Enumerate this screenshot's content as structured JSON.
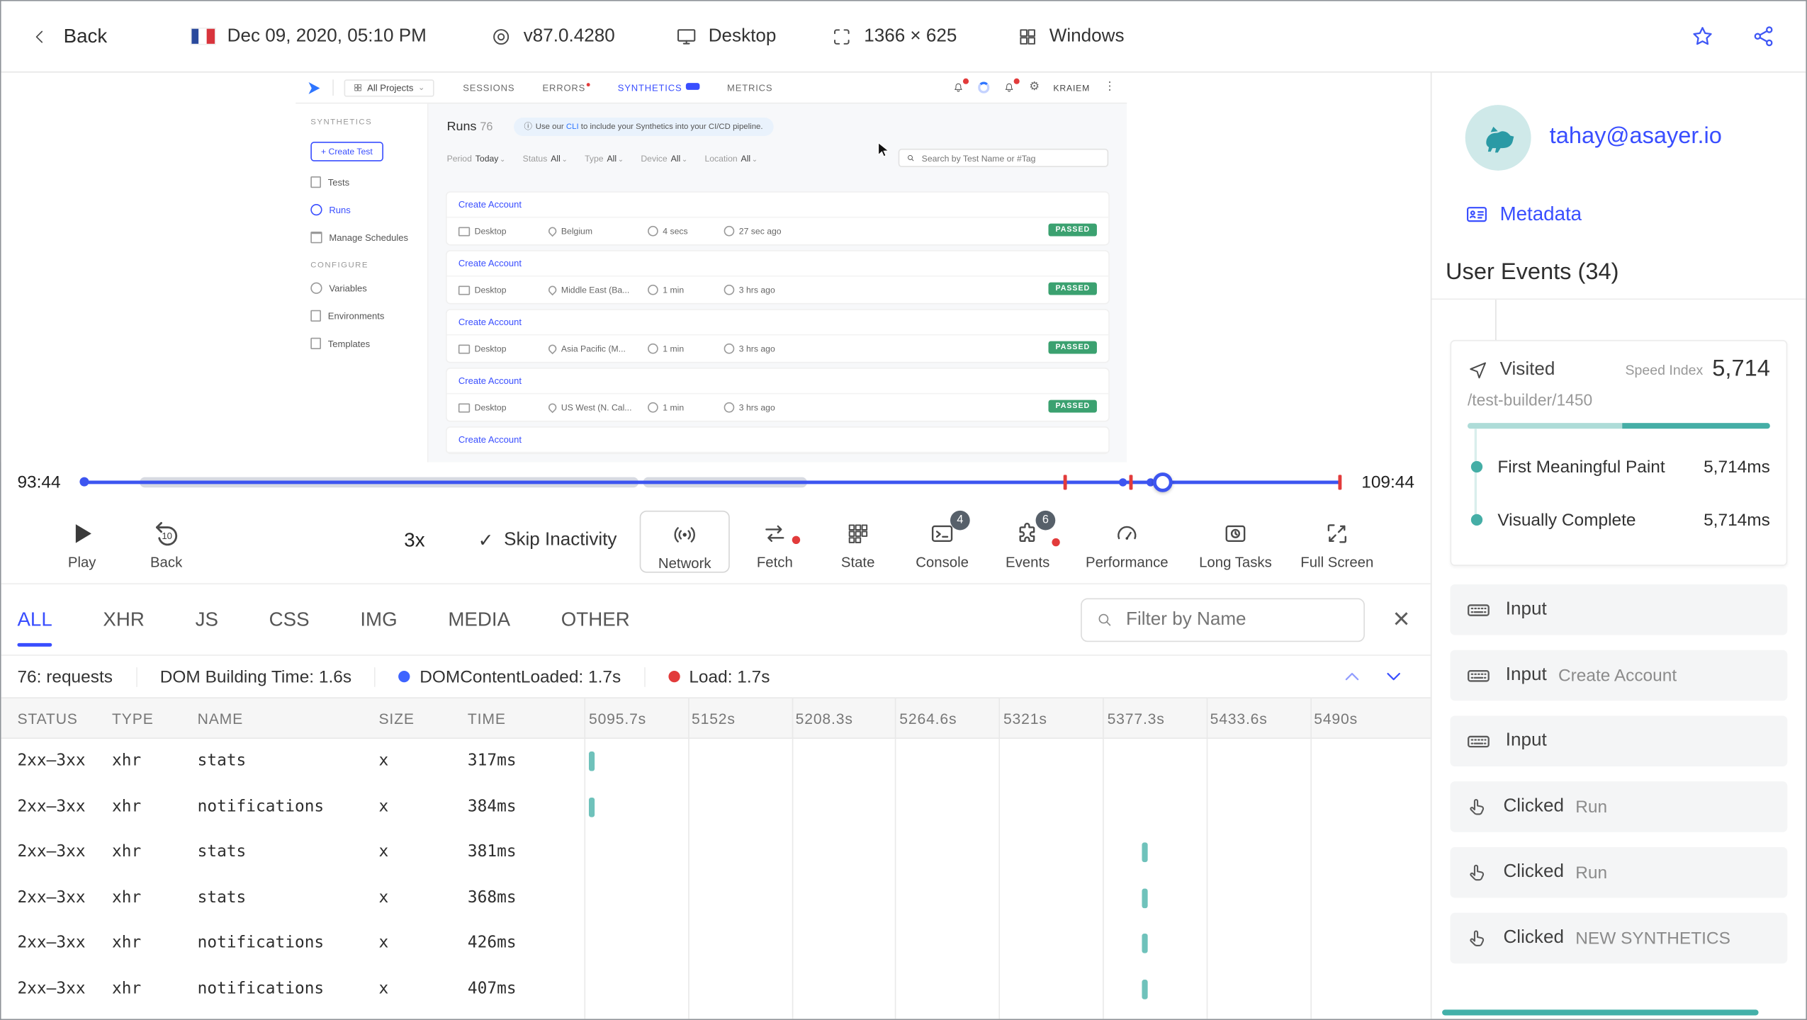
{
  "icons": {
    "caret": "⌄",
    "close": "×",
    "check": "✓",
    "kebab": "⋮",
    "info": "ⓘ",
    "gear": "⚙"
  },
  "topbar": {
    "back_label": "Back",
    "date": "Dec 09, 2020, 05:10 PM",
    "browser_version": "v87.0.4280",
    "device": "Desktop",
    "resolution": "1366 × 625",
    "os": "Windows"
  },
  "app": {
    "project": "All Projects",
    "nav": [
      {
        "label": "SESSIONS"
      },
      {
        "label": "ERRORS"
      },
      {
        "label": "SYNTHETICS"
      },
      {
        "label": "METRICS"
      }
    ],
    "user": "KRAIEM",
    "sidebar": {
      "section_synthetics": "SYNTHETICS",
      "create_test": "+ Create Test",
      "tests": "Tests",
      "runs": "Runs",
      "manage_schedules": "Manage Schedules",
      "section_configure": "CONFIGURE",
      "variables": "Variables",
      "environments": "Environments",
      "templates": "Templates"
    },
    "runs_title": "Runs",
    "runs_count": "76",
    "banner": {
      "pre": "Use our ",
      "link": "CLI",
      "post": " to include your Synthetics into your CI/CD pipeline."
    },
    "filters": [
      {
        "label": "Period",
        "value": "Today"
      },
      {
        "label": "Status",
        "value": "All"
      },
      {
        "label": "Type",
        "value": "All"
      },
      {
        "label": "Device",
        "value": "All"
      },
      {
        "label": "Location",
        "value": "All"
      }
    ],
    "search_placeholder": "Search by Test Name or #Tag",
    "runs": [
      {
        "name": "Create Account",
        "device": "Desktop",
        "location": "Belgium",
        "duration": "4 secs",
        "ago": "27 sec ago",
        "status": "PASSED"
      },
      {
        "name": "Create Account",
        "device": "Desktop",
        "location": "Middle East (Ba...",
        "duration": "1 min",
        "ago": "3 hrs ago",
        "status": "PASSED"
      },
      {
        "name": "Create Account",
        "device": "Desktop",
        "location": "Asia Pacific (M...",
        "duration": "1 min",
        "ago": "3 hrs ago",
        "status": "PASSED"
      },
      {
        "name": "Create Account",
        "device": "Desktop",
        "location": "US West (N. Cal...",
        "duration": "1 min",
        "ago": "3 hrs ago",
        "status": "PASSED"
      },
      {
        "name": "Create Account"
      }
    ]
  },
  "timeline": {
    "current": "93:44",
    "total": "109:44"
  },
  "controls": {
    "play": "Play",
    "back": "Back",
    "back_amount": "10",
    "speed": "3x",
    "skip": "Skip Inactivity",
    "panels": [
      {
        "label": "Network"
      },
      {
        "label": "Fetch"
      },
      {
        "label": "State"
      },
      {
        "label": "Console",
        "badge": "4"
      },
      {
        "label": "Events",
        "badge": "6"
      },
      {
        "label": "Performance"
      },
      {
        "label": "Long Tasks"
      },
      {
        "label": "Full Screen"
      }
    ]
  },
  "network": {
    "tabs": [
      "ALL",
      "XHR",
      "JS",
      "CSS",
      "IMG",
      "MEDIA",
      "OTHER"
    ],
    "active_tab": "ALL",
    "filter_placeholder": "Filter by Name",
    "stats": {
      "requests": "76: requests",
      "dom_building": "DOM Building Time: 1.6s",
      "dcl": "DOMContentLoaded: 1.7s",
      "load": "Load: 1.7s"
    },
    "columns": {
      "status": "STATUS",
      "type": "TYPE",
      "name": "NAME",
      "size": "SIZE",
      "time": "TIME"
    },
    "time_ticks": [
      "5095.7s",
      "5152s",
      "5208.3s",
      "5264.6s",
      "5321s",
      "5377.3s",
      "5433.6s",
      "5490s"
    ],
    "rows": [
      {
        "status": "2xx–3xx",
        "type": "xhr",
        "name": "stats",
        "size": "x",
        "time": "317ms",
        "waterfall_pct": 1
      },
      {
        "status": "2xx–3xx",
        "type": "xhr",
        "name": "notifications",
        "size": "x",
        "time": "384ms",
        "waterfall_pct": 1
      },
      {
        "status": "2xx–3xx",
        "type": "xhr",
        "name": "stats",
        "size": "x",
        "time": "381ms",
        "waterfall_pct": 66
      },
      {
        "status": "2xx–3xx",
        "type": "xhr",
        "name": "stats",
        "size": "x",
        "time": "368ms",
        "waterfall_pct": 66
      },
      {
        "status": "2xx–3xx",
        "type": "xhr",
        "name": "notifications",
        "size": "x",
        "time": "426ms",
        "waterfall_pct": 66
      },
      {
        "status": "2xx–3xx",
        "type": "xhr",
        "name": "notifications",
        "size": "x",
        "time": "407ms",
        "waterfall_pct": 66
      }
    ]
  },
  "user_panel": {
    "email": "tahay@asayer.io",
    "metadata": "Metadata",
    "events_title": "User Events (34)",
    "visited": {
      "label": "Visited",
      "speed_index_label": "Speed Index",
      "speed_index": "5,714",
      "path": "/test-builder/1450",
      "metrics": [
        {
          "name": "First Meaningful Paint",
          "value": "5,714ms"
        },
        {
          "name": "Visually Complete",
          "value": "5,714ms"
        }
      ]
    },
    "events": [
      {
        "label": "Input",
        "value": ""
      },
      {
        "label": "Input",
        "value": "Create Account"
      },
      {
        "label": "Input",
        "value": ""
      },
      {
        "label": "Clicked",
        "value": "Run"
      },
      {
        "label": "Clicked",
        "value": "Run"
      },
      {
        "label": "Clicked",
        "value": "NEW SYNTHETICS"
      }
    ]
  },
  "colors": {
    "accent": "#394EFF",
    "teal": "#6FC2BB",
    "green": "#3BA170",
    "red": "#E23B3B"
  }
}
